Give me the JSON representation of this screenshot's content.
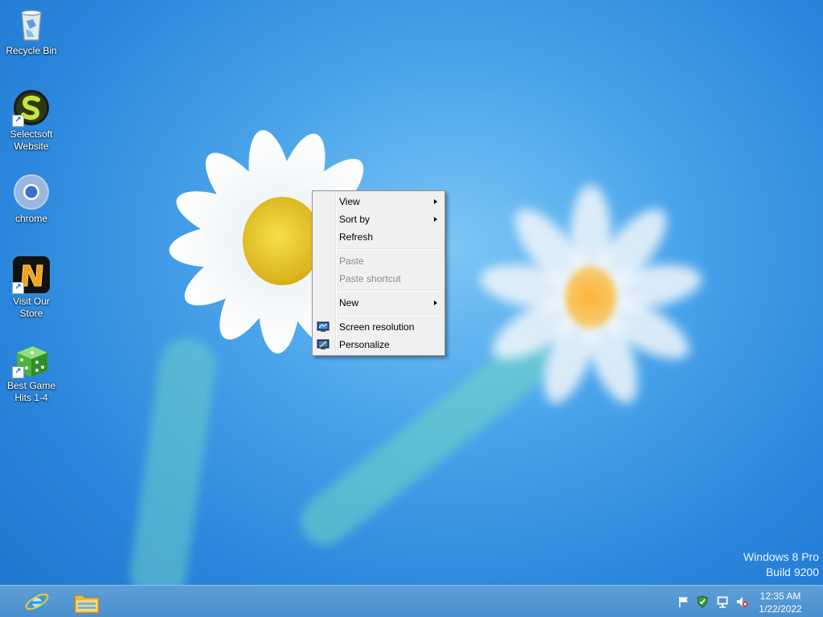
{
  "desktop_icons": [
    {
      "label_line1": "Recycle Bin",
      "label_line2": "",
      "icon": "recycle-bin-icon"
    },
    {
      "label_line1": "Selectsoft",
      "label_line2": "Website",
      "icon": "selectsoft-icon"
    },
    {
      "label_line1": "chrome",
      "label_line2": "",
      "icon": "chrome-icon"
    },
    {
      "label_line1": "Visit Our",
      "label_line2": "Store",
      "icon": "store-icon"
    },
    {
      "label_line1": "Best Game",
      "label_line2": "Hits 1-4",
      "icon": "dice-icon"
    }
  ],
  "context_menu": {
    "items": [
      {
        "label": "View",
        "submenu": true,
        "disabled": false
      },
      {
        "label": "Sort by",
        "submenu": true,
        "disabled": false
      },
      {
        "label": "Refresh",
        "submenu": false,
        "disabled": false
      },
      {
        "label": "Paste",
        "submenu": false,
        "disabled": true
      },
      {
        "label": "Paste shortcut",
        "submenu": false,
        "disabled": true
      },
      {
        "label": "New",
        "submenu": true,
        "disabled": false
      },
      {
        "label": "Screen resolution",
        "submenu": false,
        "disabled": false,
        "icon": "monitor-icon"
      },
      {
        "label": "Personalize",
        "submenu": false,
        "disabled": false,
        "icon": "personalize-icon"
      }
    ]
  },
  "watermark": {
    "edition": "Windows 8 Pro",
    "build": "Build 9200"
  },
  "taskbar": {
    "pinned": [
      {
        "icon": "internet-explorer-icon"
      },
      {
        "icon": "file-explorer-icon"
      }
    ],
    "tray": [
      {
        "icon": "action-center-flag-icon"
      },
      {
        "icon": "security-shield-icon"
      },
      {
        "icon": "network-icon"
      },
      {
        "icon": "volume-muted-icon"
      }
    ],
    "clock": {
      "time": "12:35 AM",
      "date": "1/22/2022"
    }
  },
  "colors": {
    "desktop_blue": "#2a86dc",
    "taskbar": "#4a8fcd",
    "menu_bg": "#f0f0f0",
    "disabled_text": "#8d8d8d"
  }
}
